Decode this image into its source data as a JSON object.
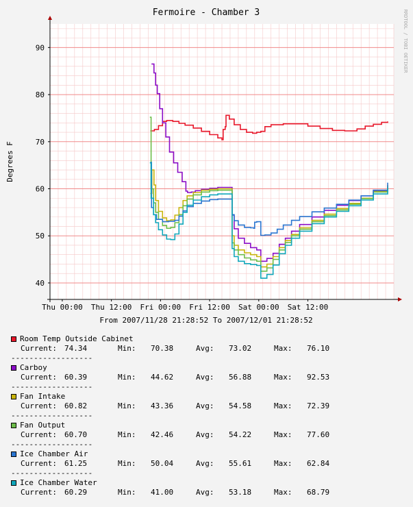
{
  "chart_data": {
    "type": "line",
    "title": "Fermoire - Chamber 3",
    "ylabel": "Degrees F",
    "watermark": "RRDTOOL / TOBI OETIKER",
    "xlabel": "From 2007/11/28 21:28:52 To 2007/12/01 21:28:52",
    "x_ticks": [
      "Thu 00:00",
      "Thu 12:00",
      "Fri 00:00",
      "Fri 12:00",
      "Sat 00:00",
      "Sat 12:00"
    ],
    "y_ticks": [
      "40",
      "50",
      "60",
      "70",
      "80",
      "90"
    ],
    "xlim_hours": [
      -3,
      81
    ],
    "ylim": [
      36.5,
      95
    ],
    "grid": true,
    "stat_labels": {
      "current": "Current:",
      "min": "Min:",
      "avg": "Avg:",
      "max": "Max:"
    },
    "separator": "------------------",
    "series": [
      {
        "name": "Room Temp Outside Cabinet",
        "color": "#e8172a",
        "stats": {
          "current": "74.34",
          "min": "70.38",
          "avg": "73.02",
          "max": "76.10"
        },
        "points": [
          [
            21.5,
            72.3
          ],
          [
            22.5,
            72.6
          ],
          [
            23.5,
            73.4
          ],
          [
            24.5,
            74.3
          ],
          [
            25.5,
            74.5
          ],
          [
            27,
            74.3
          ],
          [
            28.5,
            73.9
          ],
          [
            30,
            73.5
          ],
          [
            32,
            72.9
          ],
          [
            34,
            72.2
          ],
          [
            36,
            71.5
          ],
          [
            38,
            70.8
          ],
          [
            39,
            70.4
          ],
          [
            39.3,
            72.6
          ],
          [
            39.8,
            73.2
          ],
          [
            40,
            75.6
          ],
          [
            40.8,
            74.8
          ],
          [
            42,
            73.6
          ],
          [
            43.5,
            72.6
          ],
          [
            45,
            72.0
          ],
          [
            46.5,
            71.8
          ],
          [
            47.5,
            72.0
          ],
          [
            48.5,
            72.2
          ],
          [
            49.5,
            73.2
          ],
          [
            51,
            73.6
          ],
          [
            54,
            73.8
          ],
          [
            57,
            73.8
          ],
          [
            60,
            73.3
          ],
          [
            63,
            72.8
          ],
          [
            66,
            72.4
          ],
          [
            69,
            72.3
          ],
          [
            72,
            72.7
          ],
          [
            74,
            73.3
          ],
          [
            76,
            73.7
          ],
          [
            78,
            74.1
          ],
          [
            79.5,
            74.3
          ]
        ]
      },
      {
        "name": "Carboy",
        "color": "#8b0dc7",
        "stats": {
          "current": "60.39",
          "min": "44.62",
          "avg": "56.88",
          "max": "92.53"
        },
        "points": [
          [
            21.8,
            86.5
          ],
          [
            22.4,
            84.6
          ],
          [
            22.8,
            82.0
          ],
          [
            23.2,
            80.2
          ],
          [
            23.8,
            77.0
          ],
          [
            24.5,
            74.0
          ],
          [
            25.3,
            71.0
          ],
          [
            26.2,
            67.8
          ],
          [
            27.2,
            65.5
          ],
          [
            28.2,
            63.5
          ],
          [
            29.3,
            61.5
          ],
          [
            30.2,
            59.5
          ],
          [
            30.6,
            59.2
          ],
          [
            31.5,
            59.3
          ],
          [
            32.5,
            59.6
          ],
          [
            34,
            59.9
          ],
          [
            36,
            60.1
          ],
          [
            38,
            60.3
          ],
          [
            41,
            60.3
          ],
          [
            41.5,
            54.4
          ],
          [
            42,
            51.5
          ],
          [
            43,
            49.5
          ],
          [
            44.5,
            48.4
          ],
          [
            46,
            47.5
          ],
          [
            47.5,
            47.0
          ],
          [
            48.5,
            44.6
          ],
          [
            50,
            45.2
          ],
          [
            51.5,
            46.3
          ],
          [
            53,
            48.2
          ],
          [
            54.5,
            49.5
          ],
          [
            56,
            51.0
          ],
          [
            58,
            52.4
          ],
          [
            61,
            54.0
          ],
          [
            64,
            55.4
          ],
          [
            67,
            56.5
          ],
          [
            70,
            57.5
          ],
          [
            73,
            58.5
          ],
          [
            76,
            59.6
          ],
          [
            79.5,
            60.4
          ]
        ]
      },
      {
        "name": "Fan Intake",
        "color": "#c8b40c",
        "stats": {
          "current": "60.82",
          "min": "43.36",
          "avg": "54.58",
          "max": "72.39"
        },
        "points": [
          [
            21.5,
            59.0
          ],
          [
            21.9,
            64.0
          ],
          [
            22.4,
            60.8
          ],
          [
            22.8,
            57.5
          ],
          [
            23.5,
            55.2
          ],
          [
            24.5,
            53.8
          ],
          [
            25.5,
            53.2
          ],
          [
            26.5,
            53.4
          ],
          [
            27.5,
            54.4
          ],
          [
            28.5,
            56.0
          ],
          [
            29.5,
            57.5
          ],
          [
            30.5,
            58.5
          ],
          [
            32,
            59.2
          ],
          [
            34,
            59.7
          ],
          [
            36,
            59.9
          ],
          [
            38,
            60.0
          ],
          [
            41,
            60.0
          ],
          [
            41.5,
            50.0
          ],
          [
            42,
            48.0
          ],
          [
            43,
            47.0
          ],
          [
            44.5,
            46.4
          ],
          [
            46,
            46.0
          ],
          [
            47.5,
            45.6
          ],
          [
            48.5,
            43.4
          ],
          [
            50,
            44.0
          ],
          [
            51.5,
            45.6
          ],
          [
            53,
            47.5
          ],
          [
            54.5,
            49.0
          ],
          [
            56,
            50.3
          ],
          [
            58,
            51.7
          ],
          [
            61,
            53.3
          ],
          [
            64,
            54.6
          ],
          [
            67,
            55.8
          ],
          [
            70,
            56.9
          ],
          [
            73,
            58.0
          ],
          [
            76,
            59.4
          ],
          [
            79.5,
            60.8
          ]
        ]
      },
      {
        "name": "Fan Output",
        "color": "#6dbd4a",
        "stats": {
          "current": "60.70",
          "min": "42.46",
          "avg": "54.22",
          "max": "77.60"
        },
        "points": [
          [
            21.4,
            75.2
          ],
          [
            21.7,
            60.0
          ],
          [
            22.3,
            57.0
          ],
          [
            22.8,
            55.0
          ],
          [
            23.5,
            53.5
          ],
          [
            24.5,
            52.2
          ],
          [
            25.5,
            51.6
          ],
          [
            26.5,
            51.8
          ],
          [
            27.5,
            52.8
          ],
          [
            28.5,
            54.5
          ],
          [
            29.5,
            56.4
          ],
          [
            30.5,
            57.8
          ],
          [
            32,
            58.7
          ],
          [
            34,
            59.3
          ],
          [
            36,
            59.6
          ],
          [
            38,
            59.7
          ],
          [
            41,
            59.7
          ],
          [
            41.5,
            48.5
          ],
          [
            42,
            47.0
          ],
          [
            43,
            46.0
          ],
          [
            44.5,
            45.3
          ],
          [
            46,
            44.9
          ],
          [
            47.5,
            44.6
          ],
          [
            48.5,
            42.5
          ],
          [
            50,
            43.2
          ],
          [
            51.5,
            45.0
          ],
          [
            53,
            47.0
          ],
          [
            54.5,
            48.6
          ],
          [
            56,
            50.0
          ],
          [
            58,
            51.4
          ],
          [
            61,
            53.0
          ],
          [
            64,
            54.3
          ],
          [
            67,
            55.5
          ],
          [
            70,
            56.7
          ],
          [
            73,
            57.9
          ],
          [
            76,
            59.3
          ],
          [
            79.5,
            60.7
          ]
        ]
      },
      {
        "name": "Ice Chamber Air",
        "color": "#2a75d0",
        "stats": {
          "current": "61.25",
          "min": "50.04",
          "avg": "55.61",
          "max": "62.84"
        },
        "points": [
          [
            21.5,
            65.6
          ],
          [
            21.8,
            56.0
          ],
          [
            22.3,
            54.5
          ],
          [
            23,
            53.5
          ],
          [
            24.5,
            53.0
          ],
          [
            26,
            53.1
          ],
          [
            27.5,
            53.3
          ],
          [
            28.5,
            54.2
          ],
          [
            29.5,
            55.3
          ],
          [
            30.5,
            56.2
          ],
          [
            32,
            56.9
          ],
          [
            34,
            57.4
          ],
          [
            36,
            57.7
          ],
          [
            38,
            57.8
          ],
          [
            41,
            57.8
          ],
          [
            41.5,
            54.5
          ],
          [
            42,
            53.2
          ],
          [
            43,
            52.3
          ],
          [
            44.5,
            51.8
          ],
          [
            46,
            51.7
          ],
          [
            46.8,
            51.6
          ],
          [
            47,
            52.9
          ],
          [
            47.5,
            53.0
          ],
          [
            48.5,
            50.1
          ],
          [
            49.5,
            50.2
          ],
          [
            51,
            50.6
          ],
          [
            52.5,
            51.4
          ],
          [
            54,
            52.3
          ],
          [
            56,
            53.3
          ],
          [
            58,
            54.1
          ],
          [
            61,
            55.1
          ],
          [
            64,
            55.9
          ],
          [
            67,
            56.7
          ],
          [
            70,
            57.6
          ],
          [
            73,
            58.5
          ],
          [
            76,
            59.7
          ],
          [
            79.5,
            61.3
          ]
        ]
      },
      {
        "name": "Ice Chamber Water",
        "color": "#10a7bb",
        "stats": {
          "current": "60.29",
          "min": "41.00",
          "avg": "53.18",
          "max": "68.79"
        },
        "points": [
          [
            21.4,
            65.5
          ],
          [
            21.7,
            58.0
          ],
          [
            22.3,
            54.5
          ],
          [
            22.8,
            52.8
          ],
          [
            23.5,
            51.3
          ],
          [
            24.5,
            50.2
          ],
          [
            25.5,
            49.3
          ],
          [
            26.5,
            49.2
          ],
          [
            27.5,
            50.4
          ],
          [
            28.5,
            52.5
          ],
          [
            29.5,
            55.0
          ],
          [
            30.5,
            56.5
          ],
          [
            32,
            57.6
          ],
          [
            34,
            58.3
          ],
          [
            36,
            58.7
          ],
          [
            38,
            58.9
          ],
          [
            41,
            58.9
          ],
          [
            41.5,
            47.3
          ],
          [
            42,
            45.6
          ],
          [
            43,
            44.6
          ],
          [
            44.5,
            44.1
          ],
          [
            46,
            43.9
          ],
          [
            47.5,
            43.7
          ],
          [
            48.5,
            41.0
          ],
          [
            50,
            41.8
          ],
          [
            51.5,
            43.8
          ],
          [
            53,
            46.2
          ],
          [
            54.5,
            48.0
          ],
          [
            56,
            49.5
          ],
          [
            58,
            51.0
          ],
          [
            61,
            52.6
          ],
          [
            64,
            54.0
          ],
          [
            67,
            55.2
          ],
          [
            70,
            56.4
          ],
          [
            73,
            57.6
          ],
          [
            76,
            58.9
          ],
          [
            79.5,
            60.3
          ]
        ]
      }
    ]
  }
}
